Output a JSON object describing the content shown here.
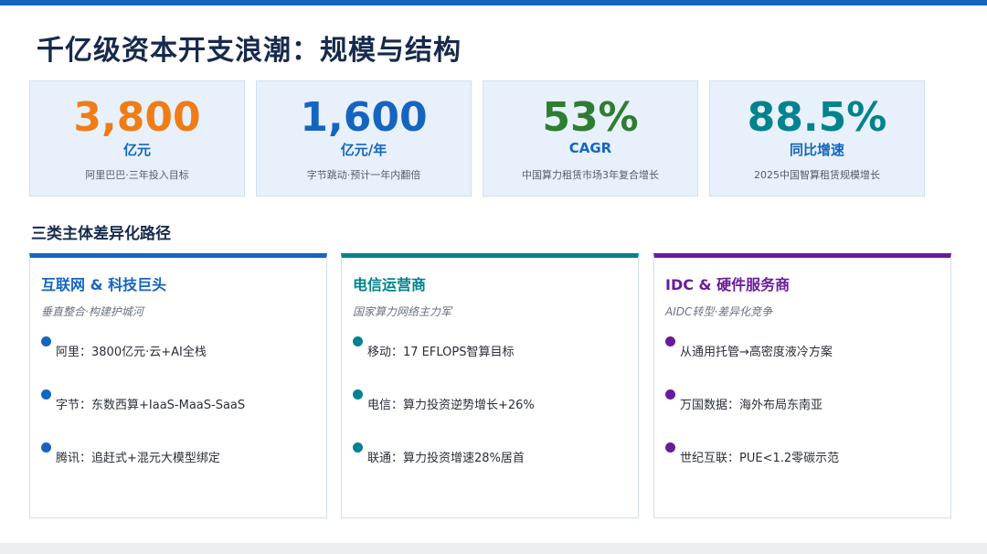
{
  "title": "千亿级资本开支浪潮：规模与结构",
  "stats": [
    {
      "value": "3,800",
      "unit": "亿元",
      "desc": "阿里巴巴·三年投入目标",
      "color": "#f07c16"
    },
    {
      "value": "1,600",
      "unit": "亿元/年",
      "desc": "字节跳动·预计一年内翻倍",
      "color": "#1565c0"
    },
    {
      "value": "53%",
      "unit": "CAGR",
      "desc": "中国算力租赁市场3年复合增长",
      "color": "#2e7d32"
    },
    {
      "value": "88.5%",
      "unit": "同比增速",
      "desc": "2025中国智算租赁规模增长",
      "color": "#00838f"
    }
  ],
  "section_title": "三类主体差异化路径",
  "cards": [
    {
      "title": "互联网 & 科技巨头",
      "subtitle": "垂直整合·构建护城河",
      "color": "#1565c0",
      "items": [
        "阿里：3800亿元·云+AI全栈",
        "字节：东数西算+IaaS-MaaS-SaaS",
        "腾讯：追赶式+混元大模型绑定"
      ]
    },
    {
      "title": "电信运营商",
      "subtitle": "国家算力网络主力军",
      "color": "#00838f",
      "items": [
        "移动：17 EFLOPS智算目标",
        "电信：算力投资逆势增长+26%",
        "联通：算力投资增速28%居首"
      ]
    },
    {
      "title": "IDC & 硬件服务商",
      "subtitle": "AIDC转型·差异化竞争",
      "color": "#6a1b9a",
      "items": [
        "从通用托管→高密度液冷方案",
        "万国数据：海外布局东南亚",
        "世纪互联：PUE<1.2零碳示范"
      ]
    }
  ]
}
